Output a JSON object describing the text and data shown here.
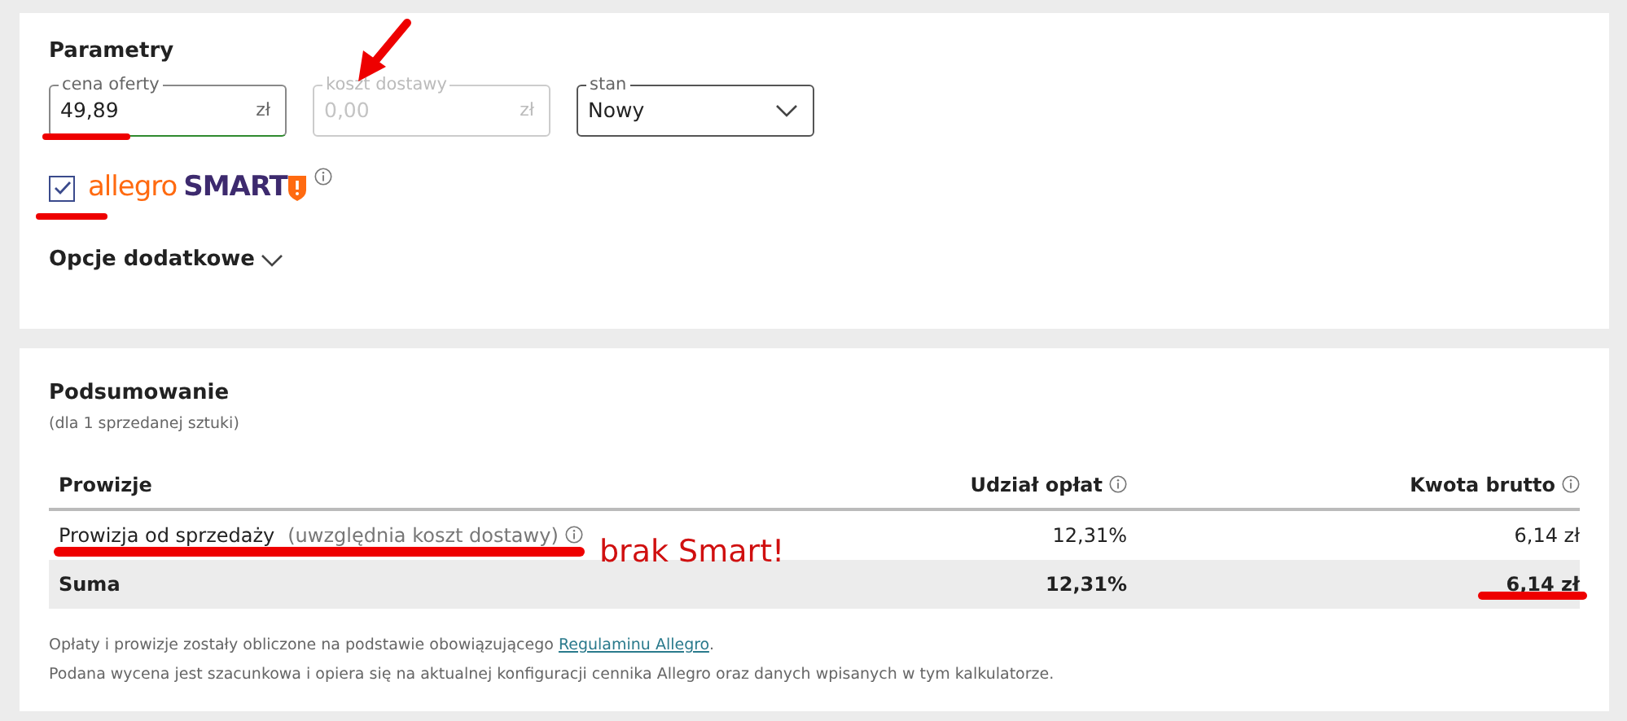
{
  "parameters": {
    "title": "Parametry",
    "fields": [
      {
        "kind": "text",
        "label": "cena oferty",
        "value": "49,89",
        "suffix": "zł",
        "disabled": false
      },
      {
        "kind": "text",
        "label": "koszt dostawy",
        "placeholder": "0,00",
        "suffix": "zł",
        "disabled": true
      },
      {
        "kind": "select",
        "label": "stan",
        "value": "Nowy"
      }
    ],
    "smart": {
      "checked": true,
      "brand": "allegro",
      "brand_suffix": "SMART"
    },
    "extra_options": {
      "label": "Opcje dodatkowe",
      "expanded": false
    }
  },
  "summary": {
    "title": "Podsumowanie",
    "subtitle": "(dla 1 sprzedanej sztuki)",
    "columns": [
      {
        "label": "Prowizje",
        "info": false
      },
      {
        "label": "Udział opłat",
        "info": true
      },
      {
        "label": "Kwota brutto",
        "info": true
      }
    ],
    "rows": [
      {
        "kind": "item",
        "name": "Prowizja od sprzedaży",
        "note": "(uwzględnia koszt dostawy)",
        "info": true,
        "share": "12,31%",
        "amount": "6,14 zł"
      },
      {
        "kind": "total",
        "name": "Suma",
        "share": "12,31%",
        "amount": "6,14 zł"
      }
    ],
    "notes": [
      {
        "text": "Opłaty i prowizje zostały obliczone na podstawie obowiązującego",
        "link": "Regulaminu Allegro",
        "after": "."
      },
      {
        "text": "Podana wycena jest szacunkowa i opiera się na aktualnej konfiguracji cennika Allegro oraz danych wpisanych w tym kalkulatorze."
      }
    ]
  },
  "annotations": [
    {
      "kind": "arrow"
    },
    {
      "kind": "underline"
    },
    {
      "kind": "underline"
    },
    {
      "kind": "underline"
    },
    {
      "kind": "text",
      "text": "brak Smart!"
    },
    {
      "kind": "underline"
    }
  ]
}
